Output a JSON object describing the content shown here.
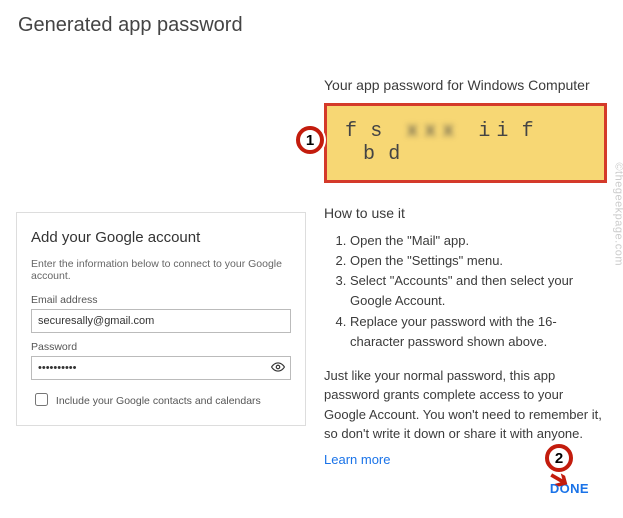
{
  "page_title": "Generated app password",
  "right": {
    "heading": "Your app password for Windows Computer",
    "password_segments": [
      "f",
      "s",
      "ii",
      "f",
      "b",
      "d"
    ],
    "howto_heading": "How to use it",
    "howto_steps": [
      "Open the \"Mail\" app.",
      "Open the \"Settings\" menu.",
      "Select \"Accounts\" and then select your Google Account.",
      "Replace your password with the 16-character password shown above."
    ],
    "info_para": "Just like your normal password, this app password grants complete access to your Google Account. You won't need to remember it, so don't write it down or share it with anyone.",
    "learn_more": "Learn more",
    "done": "DONE"
  },
  "card": {
    "title": "Add your Google account",
    "sub": "Enter the information below to connect to your Google account.",
    "email_label": "Email address",
    "email_value": "securesally@gmail.com",
    "password_label": "Password",
    "password_value": "••••••••••",
    "include_label": "Include your Google contacts and calendars"
  },
  "annotations": {
    "one": "1",
    "two": "2"
  },
  "watermark": "©thegeekpage.com"
}
